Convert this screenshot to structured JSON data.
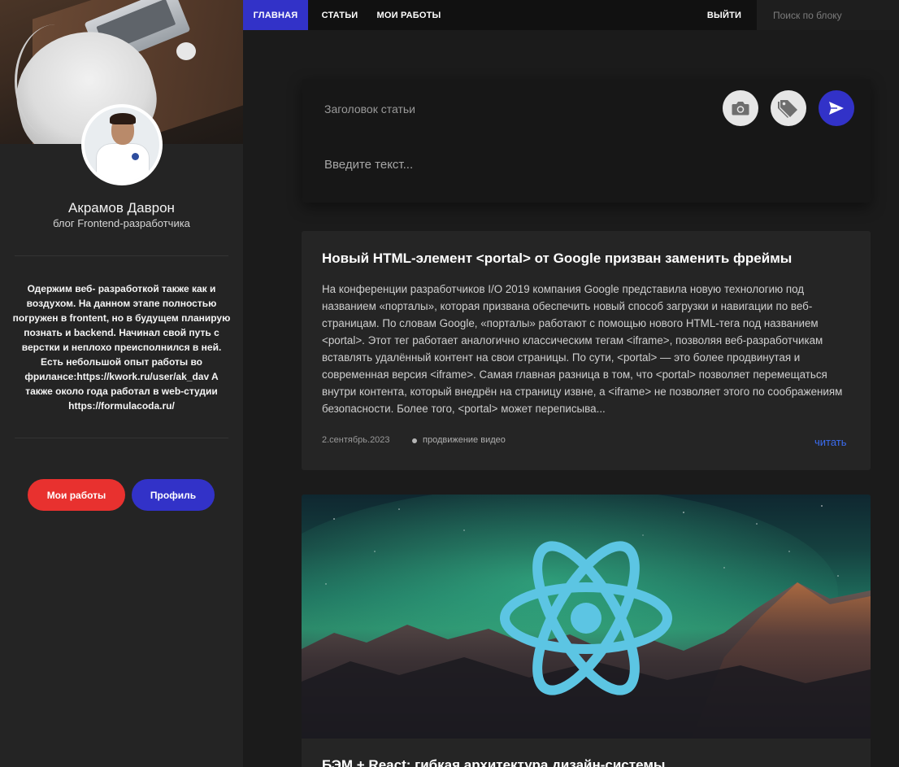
{
  "nav": {
    "home": "ГЛАВНАЯ",
    "articles": "СТАТЬИ",
    "works": "МОИ РАБОТЫ",
    "exit": "ВЫЙТИ",
    "search_placeholder": "Поиск по блоку"
  },
  "sidebar": {
    "name": "Акрамов Даврон",
    "role": "блог Frontend-разработчика",
    "bio": "Одержим веб- разработкой также как и воздухом. На данном этапе полностью погружен в frontent, но в будущем планирую познать и backend. Начинал свой путь с верстки и неплохо преисполнился в ней. Есть небольшой опыт работы во фрилансе:https://kwork.ru/user/ak_dav A также около года работал в web-студии https://formulacoda.ru/",
    "works_button": "Мои работы",
    "profile_button": "Профиль"
  },
  "composer": {
    "title_placeholder": "Заголовок статьи",
    "text_placeholder": "Введите текст...",
    "camera_icon": "camera-icon",
    "tag_icon": "tags-icon",
    "send_icon": "send-icon"
  },
  "posts": [
    {
      "title": "Новый HTML-элемент <portal> от Google призван заменить фреймы",
      "body": "На конференции разработчиков I/O 2019 компания Google представила новую технологию под названием «порталы», которая призвана обеспечить новый способ загрузки и навигации по веб-страницам. По словам Google, «порталы» работают с помощью нового HTML-тега под названием <portal>. Этот тег работает аналогично классическим тегам <iframe>, позволяя веб-разработчикам вставлять удалённый контент на свои страницы. По сути, <portal> — это более продвинутая и современная версия <iframe>. Самая главная разница в том, что <portal> позволяет перемещаться внутри контента, который внедрён на страницу извне, а <iframe> не позволяет этого по соображениям безопасности. Более того, <portal> может переписыва...",
      "date": "2.сентябрь.2023",
      "tag": "продвижение видео",
      "read_label": "читать"
    },
    {
      "title": "БЭМ + React: гибкая архитектура дизайн-системы",
      "image_icon": "react-logo-icon"
    }
  ],
  "colors": {
    "accent_blue": "#3232c8",
    "accent_red": "#e8312f",
    "link_blue": "#3b6cf0",
    "react_cyan": "#5cc5e3"
  }
}
